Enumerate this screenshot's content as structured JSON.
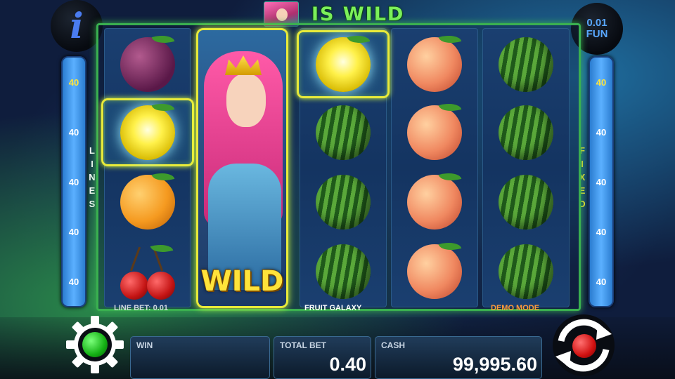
{
  "banner": {
    "text": "IS WILD",
    "icon": "princess-portrait-icon"
  },
  "info_button": {
    "glyph": "i"
  },
  "coin_button": {
    "value": "0.01",
    "label": "FUN"
  },
  "left_bar": {
    "lines": [
      "40",
      "40",
      "40",
      "40",
      "40"
    ],
    "highlighted_index": 0,
    "vertical_label": "LINES"
  },
  "right_bar": {
    "lines": [
      "40",
      "40",
      "40",
      "40",
      "40"
    ],
    "highlighted_index": 0,
    "vertical_label": "FIXED"
  },
  "reels": [
    [
      "plum",
      "lemon",
      "orange",
      "cherries"
    ],
    [
      "wild",
      "wild",
      "wild",
      "wild"
    ],
    [
      "lemon",
      "watermelon",
      "watermelon",
      "watermelon"
    ],
    [
      "peach",
      "peach",
      "peach",
      "peach"
    ],
    [
      "watermelon",
      "watermelon",
      "watermelon",
      "watermelon"
    ]
  ],
  "highlighted_cells": [
    [
      0,
      1
    ],
    [
      2,
      0
    ]
  ],
  "wild_label": "WILD",
  "captions": {
    "line_bet": "LINE BET: 0.01",
    "game_name": "FRUIT GALAXY",
    "mode": "DEMO MODE"
  },
  "panel": {
    "win_label": "WIN",
    "win_value": "",
    "total_bet_label": "TOTAL BET",
    "total_bet_value": "0.40",
    "cash_label": "CASH",
    "cash_value": "99,995.60"
  },
  "colors": {
    "frame": "#3ab050",
    "highlight": "#e8ea3a",
    "settings_light": "#14b014",
    "spin_light": "#d01010"
  },
  "icons": {
    "settings": "gear-icon",
    "spin": "spin-arrows-icon"
  }
}
